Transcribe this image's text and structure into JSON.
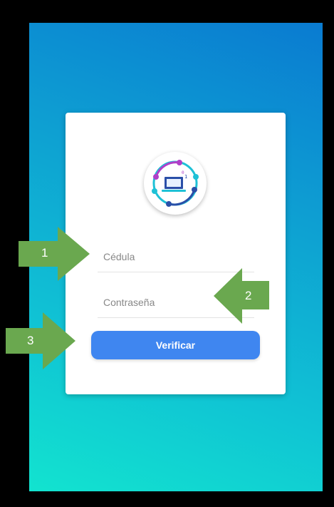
{
  "login": {
    "cedula_placeholder": "Cédula",
    "password_placeholder": "Contraseña",
    "verify_label": "Verificar"
  },
  "annotations": [
    {
      "label": "1"
    },
    {
      "label": "2"
    },
    {
      "label": "3"
    }
  ],
  "colors": {
    "primary_button": "#3f86f0",
    "callout_green": "#6aa84f",
    "gradient_top": "#0a7bd1",
    "gradient_bottom": "#12e3cf"
  },
  "icons": {
    "logo": "laptop-network-logo"
  }
}
